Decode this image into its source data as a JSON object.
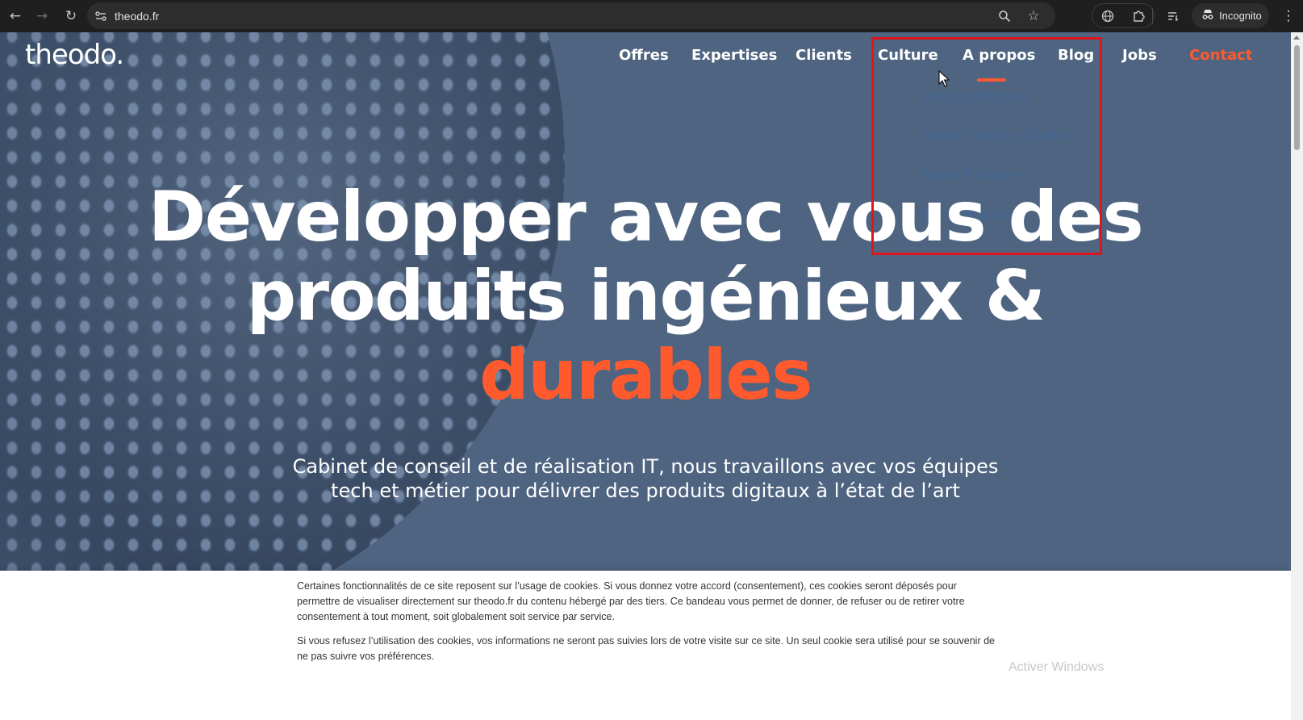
{
  "browser": {
    "url": "theodo.fr",
    "profile_label": "Incognito",
    "icons": [
      "back-icon",
      "forward-icon",
      "reload-icon",
      "site-info-icon",
      "zoom-icon",
      "bookmark-star-icon",
      "translate-icon",
      "extensions-icon",
      "reading-list-icon",
      "incognito-icon",
      "menu-icon"
    ]
  },
  "site": {
    "logo": "theodo.",
    "nav": {
      "items": [
        "Offres",
        "Expertises",
        "Clients",
        "Culture",
        "A propos",
        "Blog",
        "Jobs"
      ],
      "contact": "Contact",
      "active": "A propos"
    },
    "dropdown": {
      "items": [
        "Nos fondations",
        "Notre Startup Studio",
        "Notre histoire",
        "Notre équipe"
      ]
    },
    "hero": {
      "line1": "Développer avec vous des",
      "line2": "produits ingénieux &",
      "accent": "durables",
      "sub1": "Cabinet de conseil et de réalisation IT, nous travaillons avec vos équipes",
      "sub2": "tech et métier pour délivrer des produits digitaux à l’état de l’art"
    },
    "cookie": {
      "para1": "Certaines fonctionnalités de ce site reposent sur l’usage de cookies. Si vous donnez votre accord (consentement), ces cookies seront déposés pour permettre de visualiser directement sur theodo.fr du contenu hébergé par des tiers. Ce bandeau vous permet de donner, de refuser ou de retirer votre consentement à tout moment, soit globalement soit service par service.",
      "para2": "Si vous refusez l’utilisation des cookies, vos informations ne seront pas suivies lors de votre visite sur ce site. Un seul cookie sera utilisé pour se souvenir de ne pas suivre vos préférences."
    },
    "watermark": "Activer Windows"
  },
  "colors": {
    "accent": "#ff5a2d",
    "hero_bg": "#4e6480",
    "dropdown_text": "#3d6aa5",
    "highlight_box": "#e0141f",
    "chrome_bg": "#1f1f1f"
  }
}
